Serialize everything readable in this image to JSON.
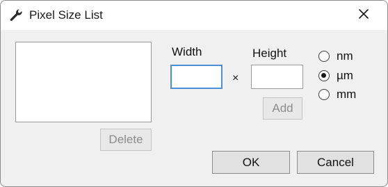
{
  "window": {
    "title": "Pixel Size List",
    "title_icon": "wrench-icon",
    "close_icon": "close-icon"
  },
  "list": {
    "items": [],
    "delete_label": "Delete"
  },
  "size": {
    "width_label": "Width",
    "height_label": "Height",
    "times_sign": "×",
    "width_value": "",
    "height_value": "",
    "add_label": "Add"
  },
  "units": {
    "options": [
      {
        "label": "nm",
        "checked": false
      },
      {
        "label": "µm",
        "checked": true
      },
      {
        "label": "mm",
        "checked": false
      }
    ]
  },
  "footer": {
    "ok_label": "OK",
    "cancel_label": "Cancel"
  },
  "colors": {
    "focus_border": "#4a90d9",
    "dialog_bg": "#f0f0f0"
  }
}
